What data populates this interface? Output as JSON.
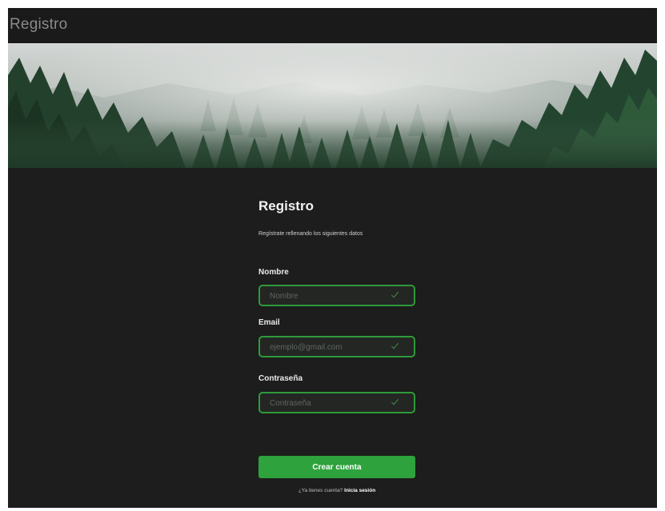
{
  "window": {
    "title": "Registro"
  },
  "banner": {
    "image": "misty-pine-forest-photo"
  },
  "form": {
    "title": "Registro",
    "subtitle": "Regístrate rellenando los siguientes datos",
    "fields": [
      {
        "label": "Nombre",
        "placeholder": "Nombre",
        "value": "",
        "valid_icon": "check-icon"
      },
      {
        "label": "Email",
        "placeholder": "ejemplo@gmail.com",
        "value": "",
        "valid_icon": "check-icon"
      },
      {
        "label": "Contraseña",
        "placeholder": "Contraseña",
        "value": "",
        "valid_icon": "check-icon"
      }
    ],
    "submit_label": "Crear cuenta",
    "login_prompt": "¿Ya tienes cuenta?",
    "login_link": "Inicia sesión"
  },
  "colors": {
    "background": "#1c1d1c",
    "topbar": "#1a1a1a",
    "accent_green": "#2ea23c",
    "field_border": "#2f9a3a"
  }
}
